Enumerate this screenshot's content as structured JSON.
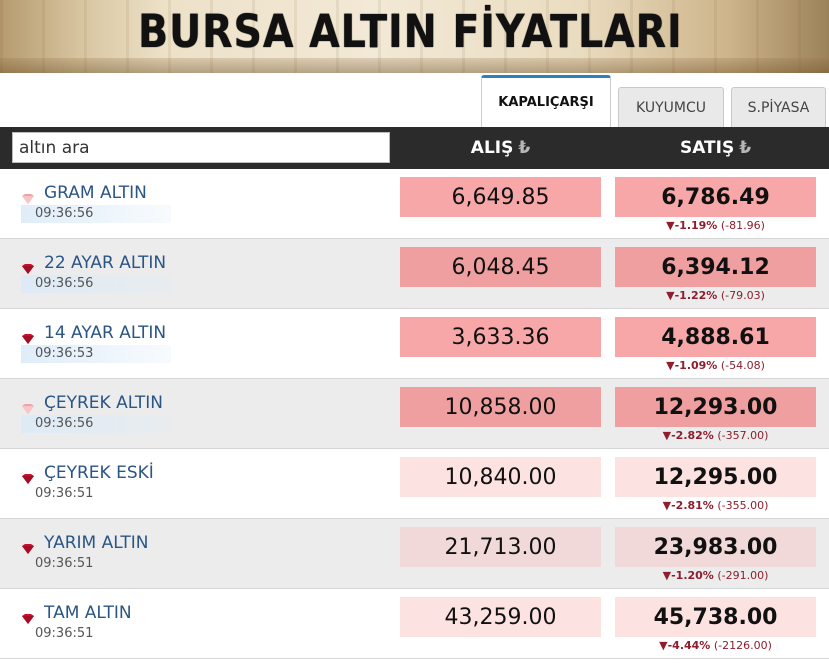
{
  "banner": {
    "title": "BURSA ALTIN FİYATLARI"
  },
  "tabs": [
    {
      "label": "KAPALIÇARŞI",
      "active": true
    },
    {
      "label": "KUYUMCU",
      "active": false
    },
    {
      "label": "S.PİYASA",
      "active": false
    }
  ],
  "search": {
    "placeholder": "altın ara",
    "value": ""
  },
  "columns": {
    "alis": "ALIŞ",
    "satis": "SATIŞ",
    "currency_symbol": "₺"
  },
  "colors": {
    "header_bar": "#2b2b2b",
    "name_text": "#2a5585",
    "change_text": "#8f1d2c",
    "tab_accent": "#2f7fbd",
    "price_strong_bg": "#f7a7a7",
    "price_strong_bg_alt": "#ef9f9f",
    "price_light_bg": "#fde2e2",
    "price_light_bg_alt": "#f1d9d9"
  },
  "rows": [
    {
      "name": "GRAM ALTIN",
      "time": "09:36:56",
      "alis": "6,649.85",
      "satis": "6,786.49",
      "change_pct": "-1.19%",
      "change_abs": "(-81.96)",
      "icon": "diamond-faded-icon",
      "highlight": true
    },
    {
      "name": "22 AYAR ALTIN",
      "time": "09:36:56",
      "alis": "6,048.45",
      "satis": "6,394.12",
      "change_pct": "-1.22%",
      "change_abs": "(-79.03)",
      "icon": "diamond-down-icon",
      "highlight": true
    },
    {
      "name": "14 AYAR ALTIN",
      "time": "09:36:53",
      "alis": "3,633.36",
      "satis": "4,888.61",
      "change_pct": "-1.09%",
      "change_abs": "(-54.08)",
      "icon": "diamond-down-icon",
      "highlight": true
    },
    {
      "name": "ÇEYREK ALTIN",
      "time": "09:36:56",
      "alis": "10,858.00",
      "satis": "12,293.00",
      "change_pct": "-2.82%",
      "change_abs": "(-357.00)",
      "icon": "diamond-faded-icon",
      "highlight": true
    },
    {
      "name": "ÇEYREK ESKİ",
      "time": "09:36:51",
      "alis": "10,840.00",
      "satis": "12,295.00",
      "change_pct": "-2.81%",
      "change_abs": "(-355.00)",
      "icon": "diamond-down-icon",
      "highlight": false
    },
    {
      "name": "YARIM ALTIN",
      "time": "09:36:51",
      "alis": "21,713.00",
      "satis": "23,983.00",
      "change_pct": "-1.20%",
      "change_abs": "(-291.00)",
      "icon": "diamond-down-icon",
      "highlight": false
    },
    {
      "name": "TAM ALTIN",
      "time": "09:36:51",
      "alis": "43,259.00",
      "satis": "45,738.00",
      "change_pct": "-4.44%",
      "change_abs": "(-2126.00)",
      "icon": "diamond-down-icon",
      "highlight": false
    }
  ]
}
